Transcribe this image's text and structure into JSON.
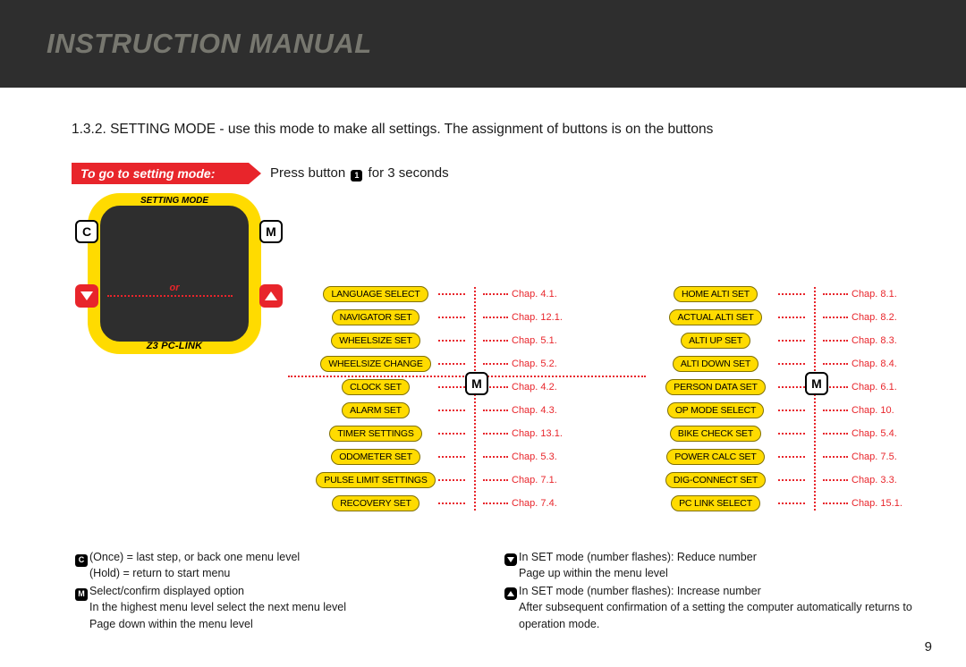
{
  "header": {
    "title": "INSTRUCTION MANUAL"
  },
  "intro": "1.3.2. SETTING MODE - use this mode to make all settings. The assignment of buttons is on the buttons",
  "ribbon": "To go to setting mode:",
  "ribbon_text_prefix": "Press button ",
  "ribbon_text_suffix": " for 3 seconds",
  "button_num": "1",
  "device": {
    "top": "SETTING MODE",
    "bottom": "Z3 PC-LINK",
    "or": "or",
    "c": "C",
    "m": "M"
  },
  "m_label": "M",
  "col1": [
    {
      "label": "LANGUAGE SELECT",
      "chap": "Chap. 4.1."
    },
    {
      "label": "NAVIGATOR SET",
      "chap": "Chap. 12.1."
    },
    {
      "label": "WHEELSIZE SET",
      "chap": "Chap. 5.1."
    },
    {
      "label": "WHEELSIZE CHANGE",
      "chap": "Chap. 5.2."
    },
    {
      "label": "CLOCK SET",
      "chap": "Chap. 4.2."
    },
    {
      "label": "ALARM SET",
      "chap": "Chap. 4.3."
    },
    {
      "label": "TIMER SETTINGS",
      "chap": "Chap. 13.1."
    },
    {
      "label": "ODOMETER SET",
      "chap": "Chap. 5.3."
    },
    {
      "label": "PULSE LIMIT SETTINGS",
      "chap": "Chap. 7.1."
    },
    {
      "label": "RECOVERY SET",
      "chap": "Chap. 7.4."
    }
  ],
  "col2": [
    {
      "label": "HOME ALTI SET",
      "chap": "Chap. 8.1."
    },
    {
      "label": "ACTUAL ALTI SET",
      "chap": "Chap. 8.2."
    },
    {
      "label": "ALTI UP SET",
      "chap": "Chap. 8.3."
    },
    {
      "label": "ALTI DOWN SET",
      "chap": "Chap. 8.4."
    },
    {
      "label": "PERSON DATA SET",
      "chap": "Chap. 6.1."
    },
    {
      "label": "OP MODE SELECT",
      "chap": "Chap. 10."
    },
    {
      "label": "BIKE CHECK SET",
      "chap": "Chap. 5.4."
    },
    {
      "label": "POWER CALC SET",
      "chap": "Chap. 7.5."
    },
    {
      "label": "DIG-CONNECT SET",
      "chap": "Chap. 3.3."
    },
    {
      "label": "PC LINK SELECT",
      "chap": "Chap. 15.1."
    }
  ],
  "legend": {
    "c1": "(Once) = last step, or back one menu level",
    "c2": "(Hold) = return to start menu",
    "m1": "Select/confirm displayed option",
    "m2": "In the highest menu level select the next menu level",
    "m3": "Page down within the menu level",
    "d1": "In SET mode (number flashes): Reduce number",
    "d2": "Page up within the menu level",
    "u1": "In SET mode (number flashes): Increase number",
    "u2": "After subsequent confirmation of a setting the computer automatically returns to operation mode."
  },
  "page": "9"
}
